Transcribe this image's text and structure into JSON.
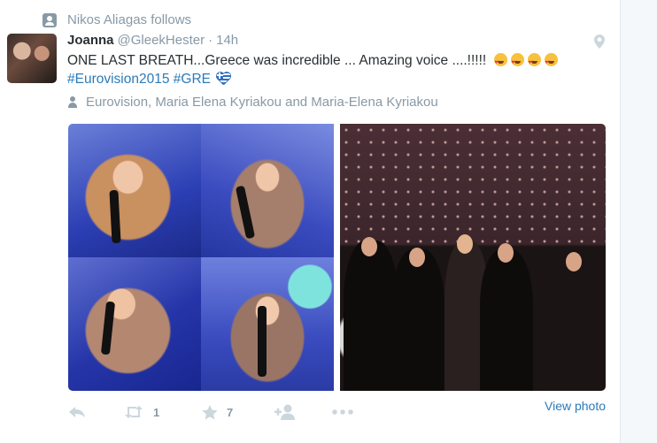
{
  "context": {
    "text": "Nikos Aliagas follows"
  },
  "tweet": {
    "name": "Joanna",
    "handle": "@GleekHester",
    "separator": "·",
    "time": "14h",
    "text": "ONE LAST BREATH...Greece was incredible ... Amazing voice ....!!!!!",
    "hashtags": [
      "#Eurovision2015",
      "#GRE"
    ],
    "location": "Eurovision, Maria Elena Kyriakou and Maria-Elena Kyriakou"
  },
  "actions": {
    "retweet_count": "1",
    "favorite_count": "7",
    "view_photo": "View photo"
  },
  "colors": {
    "link": "#2b7bb9",
    "muted": "#8899a6",
    "text": "#292f33"
  }
}
